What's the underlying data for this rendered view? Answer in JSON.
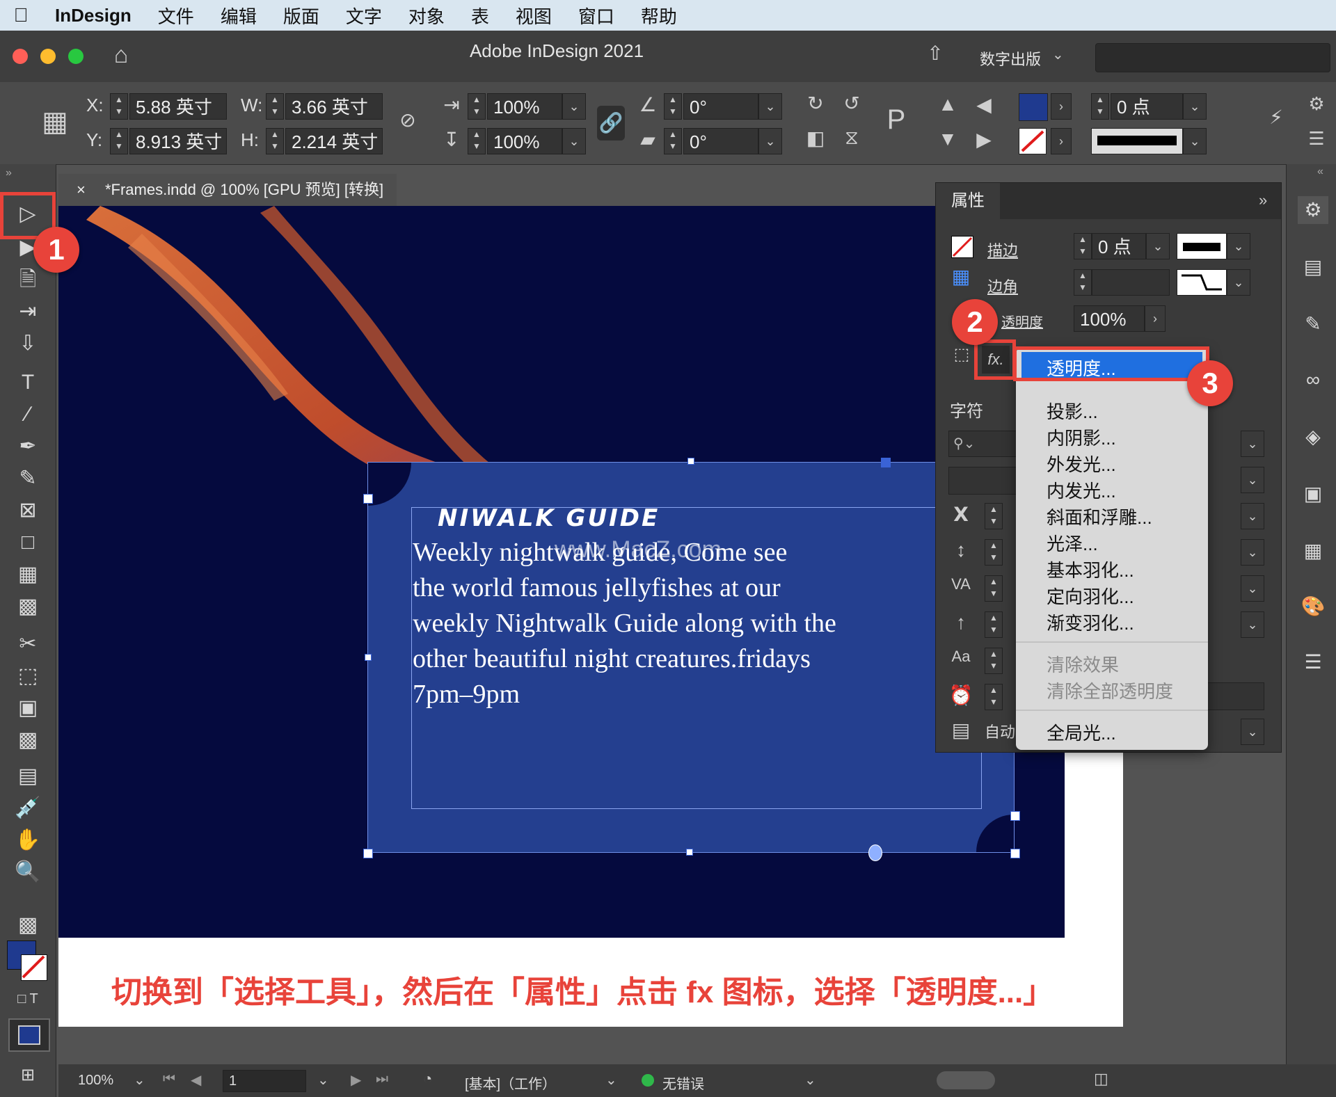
{
  "menubar": {
    "items": [
      "InDesign",
      "文件",
      "编辑",
      "版面",
      "文字",
      "对象",
      "表",
      "视图",
      "窗口",
      "帮助"
    ]
  },
  "titlebar": {
    "title": "Adobe InDesign 2021",
    "workspace": "数字出版"
  },
  "control": {
    "x_label": "X:",
    "x_value": "5.88 英寸",
    "y_label": "Y:",
    "y_value": "8.913 英寸",
    "w_label": "W:",
    "w_value": "3.66 英寸",
    "h_label": "H:",
    "h_value": "2.214 英寸",
    "scale_x": "100%",
    "scale_y": "100%",
    "rotate": "0°",
    "shear": "0°",
    "stroke_weight": "0 点",
    "fill_color": "#1f3a8f"
  },
  "document_tab": {
    "close": "×",
    "title": "*Frames.indd @ 100% [GPU 预览] [转换]"
  },
  "canvas_text": {
    "heading": "NIWALK  GUIDE",
    "body_lines": [
      " Weekly nightwalk guide, Come see",
      "the world famous jellyfishes at our",
      "weekly Nightwalk Guide along with the",
      "other beautiful night creatures.fridays",
      "7pm–9pm"
    ],
    "watermark": "www.MacZ.com"
  },
  "properties_panel": {
    "tab": "属性",
    "stroke_label": "描边",
    "stroke_value": "0 点",
    "corner_label": "边角",
    "opacity_label": "透明度",
    "opacity_value": "100%",
    "fx_label": "fx.",
    "char_section": "字符",
    "auto_label": "自动"
  },
  "fx_menu": {
    "items": [
      "透明度...",
      "投影...",
      "内阴影...",
      "外发光...",
      "内发光...",
      "斜面和浮雕...",
      "光泽...",
      "基本羽化...",
      "定向羽化...",
      "渐变羽化..."
    ],
    "disabled_items": [
      "清除效果",
      "清除全部透明度"
    ],
    "last_item": "全局光..."
  },
  "annotations": {
    "badge1": "1",
    "badge2": "2",
    "badge3": "3",
    "caption": "切换到「选择工具」，然后在「属性」点击 fx 图标，选择「透明度...」"
  },
  "statusbar": {
    "zoom": "100%",
    "page": "1",
    "mode": "[基本]（工作）",
    "preflight": "无错误"
  },
  "colors": {
    "accent_red": "#e8433a",
    "menu_highlight": "#1f6fe0",
    "frame_fill": "#243f8f",
    "night_sky": "#050a3e"
  }
}
